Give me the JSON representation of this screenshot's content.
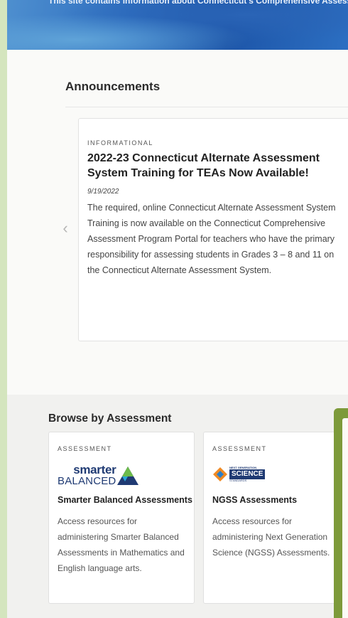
{
  "hero": {
    "text": "This site contains information about Connecticut's Comprehensive Assessme"
  },
  "announcements": {
    "title": "Announcements",
    "prev_arrow": "‹",
    "card": {
      "kicker": "INFORMATIONAL",
      "title": "2022-23 Connecticut Alternate Assessment System Training for TEAs Now Available!",
      "date": "9/19/2022",
      "body": "The required, online Connecticut Alternate Assessment System Training is now available on the Connecticut Comprehensive Assessment Program Portal for teachers who have the primary responsibility for assessing students in Grades 3 – 8 and 11 on the Connecticut Alternate Assessment System."
    }
  },
  "browse": {
    "title": "Browse by Assessment",
    "cards": [
      {
        "kicker": "ASSESSMENT",
        "logo_top": "smarter",
        "logo_bottom": "BALANCED",
        "title": "Smarter Balanced Assessments",
        "description": "Access resources for administering Smarter Balanced Assessments in Mathematics and English language arts."
      },
      {
        "kicker": "ASSESSMENT",
        "logo_small": "NEXT GENERATION",
        "logo_main": "SCIENCE",
        "logo_sub": "STANDARDS",
        "title": "NGSS Assessments",
        "description": "Access resources for administering Next Generation Science (NGSS) Assessments."
      }
    ]
  },
  "colors": {
    "page_bg": "#d4e5be",
    "hero_blue": "#2f6fc0",
    "accent_green": "#7d9a3a",
    "heading": "#2b2b2b"
  }
}
